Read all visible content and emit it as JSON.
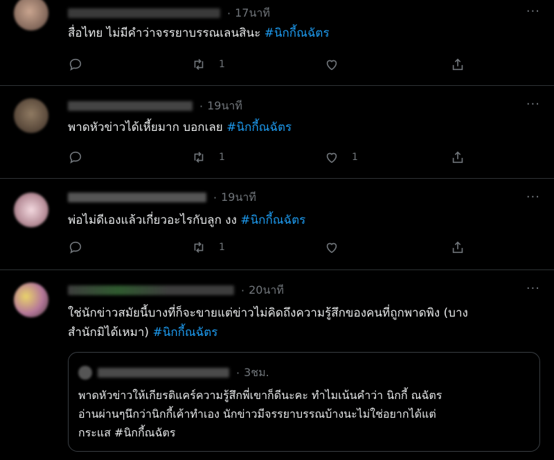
{
  "tweets": [
    {
      "time": "17นาที",
      "text": "สื่อไทย ไม่มีคำว่าจรรยาบรรณเลนสินะ",
      "hashtag": "#นิกกี้ณฉัตร",
      "retweets": "1",
      "likes": "",
      "avatar_color": "#a08070"
    },
    {
      "time": "19นาที",
      "text": "พาดหัวข่าวได้เหี้ยมาก บอกเลย ",
      "hashtag": "#นิกกี้ณฉัตร",
      "retweets": "1",
      "likes": "1",
      "avatar_color": "#6b5a48"
    },
    {
      "time": "19นาที",
      "text": "พ่อไม่ดีเองแล้วเกี่ยวอะไรกับลูก งง",
      "hashtag": "#นิกกี้ณฉัตร",
      "retweets": "1",
      "likes": "",
      "avatar_color": "#d6bcc4"
    },
    {
      "time": "20นาที",
      "text_line1": "ใช่นักข่าวสมัยนี้บางที่ก็จะขายแต่ข่าวไม่คิดถึงความรู้สึกของคนที่ถูกพาดพิง (บาง",
      "text_line2": "สำนักมิได้เหมา)",
      "hashtag": "#นิกกี้ณฉัตร",
      "avatar_color": "#b7a27a"
    }
  ],
  "quote": {
    "time": "3ชม.",
    "line1": "พาดหัวข่าวให้เกียรติแคร์ความรู้สึกพี่เขาก็ดีนะคะ ทำไมเน้นคำว่า นิกกี้ ณฉัตร",
    "line2": "อ่านผ่านๆนึกว่านิกกี้เค้าทำเอง นักข่าวมีจรรยาบรรณบ้างนะไม่ใช่อยากได้แต่",
    "line3": "กระแส #นิกกี้ณฉัตร"
  },
  "ui": {
    "more": "···",
    "dot": "·"
  },
  "colors": {
    "background": "#000000",
    "text": "#e7e9ea",
    "muted": "#71767b",
    "hashtag": "#1d9bf0",
    "divider": "#2f3336"
  }
}
